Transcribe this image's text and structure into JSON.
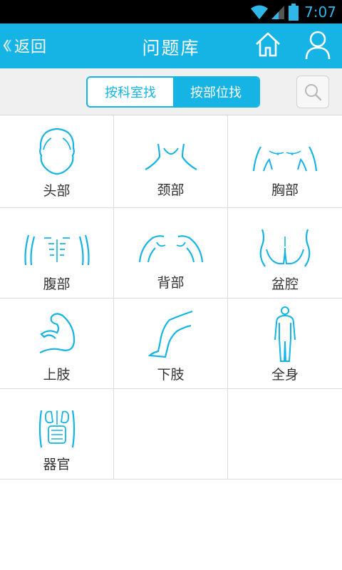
{
  "status_bar": {
    "time": "7:07"
  },
  "header": {
    "back_label": "返回",
    "title": "问题库"
  },
  "filter": {
    "tabs": [
      {
        "label": "按科室找",
        "selected": false
      },
      {
        "label": "按部位找",
        "selected": true
      }
    ]
  },
  "body_parts": [
    {
      "label": "头部",
      "icon": "head-icon"
    },
    {
      "label": "颈部",
      "icon": "neck-icon"
    },
    {
      "label": "胸部",
      "icon": "chest-icon"
    },
    {
      "label": "腹部",
      "icon": "abdomen-icon"
    },
    {
      "label": "背部",
      "icon": "back-icon"
    },
    {
      "label": "盆腔",
      "icon": "pelvis-icon"
    },
    {
      "label": "上肢",
      "icon": "arm-icon"
    },
    {
      "label": "下肢",
      "icon": "leg-icon"
    },
    {
      "label": "全身",
      "icon": "full-body-icon"
    },
    {
      "label": "器官",
      "icon": "organs-icon"
    }
  ],
  "colors": {
    "accent": "#15b4e5",
    "status_bar": "#000000",
    "filter_bg": "#f0f0f0",
    "text": "#333333"
  }
}
